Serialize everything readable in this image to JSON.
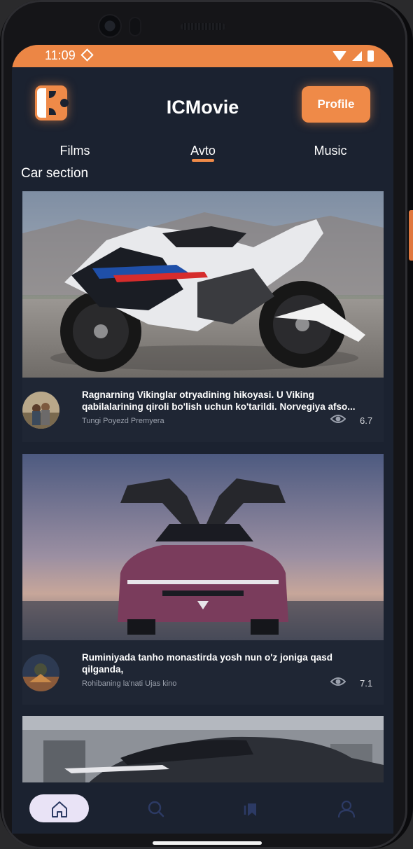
{
  "status_bar": {
    "time": "11:09",
    "icons": [
      "data-saver-icon",
      "wifi-icon",
      "signal-icon",
      "battery-icon"
    ]
  },
  "header": {
    "app_title": "ICMovie",
    "logo_icon": "app-logo-icon",
    "profile_button": "Profile"
  },
  "tabs": [
    {
      "label": "Films",
      "active": false
    },
    {
      "label": "Avto",
      "active": true
    },
    {
      "label": "Music",
      "active": false
    }
  ],
  "section_title": "Car section",
  "cards": [
    {
      "image": "motorcycle-photo",
      "avatar": "thumbnail",
      "description_line1": "Ragnarning Vikinglar otryadining hikoyasi. U Viking",
      "description_line2": "qabilalarining qiroli bo'lish uchun ko'tarildi. Norvegiya afso...",
      "subtitle": "Tungi Poyezd Premyera",
      "views_icon": "eye-icon",
      "rating": "6.7"
    },
    {
      "image": "sports-car-photo",
      "avatar": "thumbnail",
      "description_line1": "Ruminiyada tanho monastirda yosh nun o'z joniga qasd",
      "description_line2": "qilganda,",
      "subtitle": "Rohibaning la'nati Ujas kino",
      "views_icon": "eye-icon",
      "rating": "7.1"
    },
    {
      "image": "car-photo-partial"
    }
  ],
  "bottom_nav": [
    {
      "icon": "home-icon",
      "active": true
    },
    {
      "icon": "search-icon",
      "active": false
    },
    {
      "icon": "bookmarks-icon",
      "active": false
    },
    {
      "icon": "profile-icon",
      "active": false
    }
  ],
  "colors": {
    "accent": "#ef8a48",
    "background": "#1b2230",
    "card": "#1f2634",
    "nav_active": "#e9e3f6",
    "nav_inactive": "#2c3a64"
  }
}
